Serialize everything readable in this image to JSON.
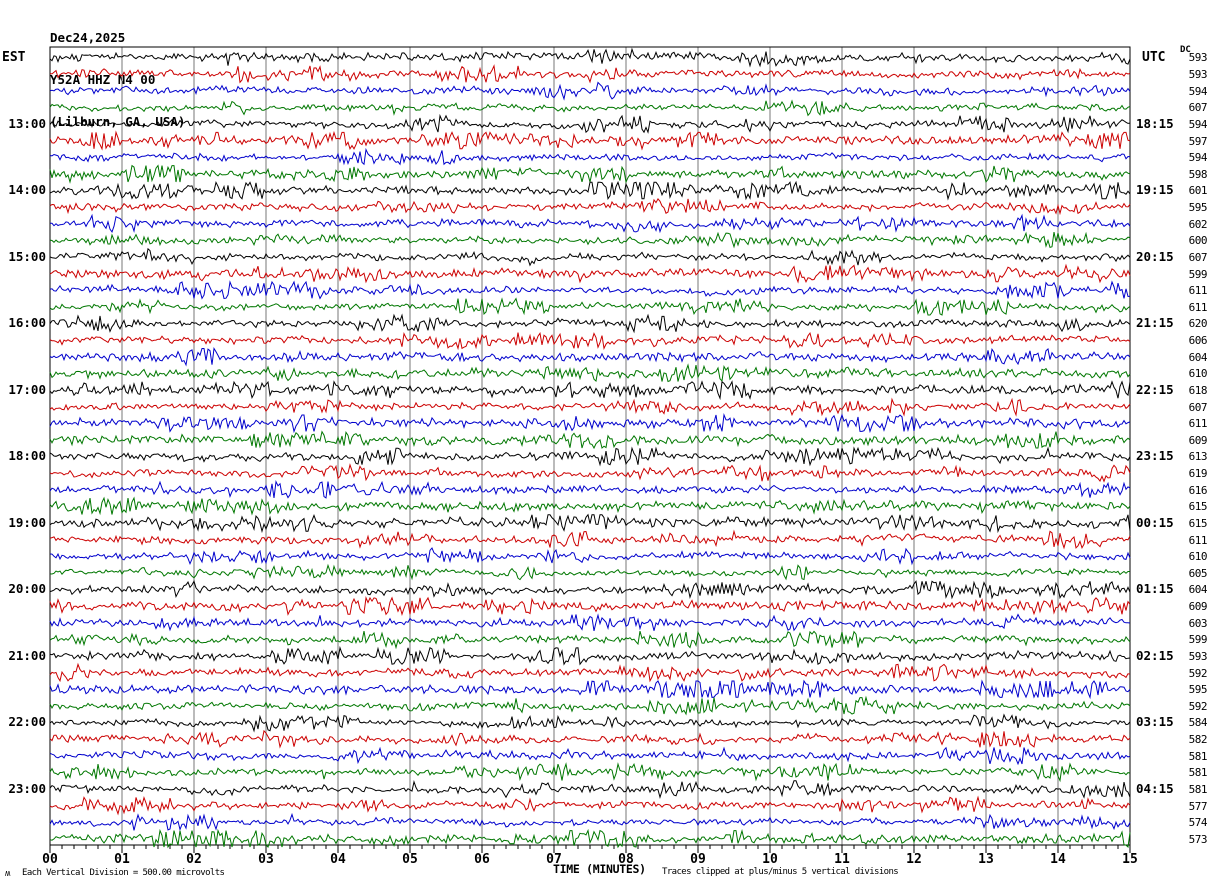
{
  "header": {
    "date": "Dec24,2025",
    "station": "Y52A HHZ N4 00",
    "location": "(Lilburn, GA, USA)"
  },
  "left_axis": {
    "timezone_label": "EST",
    "hour_labels": [
      "13:00",
      "14:00",
      "15:00",
      "16:00",
      "17:00",
      "18:00",
      "19:00",
      "20:00",
      "21:00",
      "22:00",
      "23:00"
    ]
  },
  "right_axis": {
    "timezone_label": "UTC",
    "dc_column_header": "DC",
    "hour_labels": [
      "18:15",
      "19:15",
      "20:15",
      "21:15",
      "22:15",
      "23:15",
      "00:15",
      "01:15",
      "02:15",
      "03:15",
      "04:15"
    ]
  },
  "x_axis": {
    "title": "TIME (MINUTES)",
    "minute_labels": [
      "00",
      "01",
      "02",
      "03",
      "04",
      "05",
      "06",
      "07",
      "08",
      "09",
      "10",
      "11",
      "12",
      "13",
      "14",
      "15"
    ]
  },
  "footer": {
    "scale_note": "Each Vertical Division =  500.00 microvolts",
    "clip_note": "Traces clipped at plus/minus 5 vertical divisions",
    "corner_glyph": "ʍ"
  },
  "chart_data": {
    "type": "line",
    "subtype": "helicorder_seismogram",
    "title": "Y52A HHZ N4 00 (Lilburn, GA, USA) Dec24,2025",
    "xlabel": "TIME (MINUTES)",
    "x_range_minutes": [
      0,
      15
    ],
    "major_tick_minutes": 1,
    "minor_tick_seconds": 10,
    "rows_total": 48,
    "row_duration_minutes": 15,
    "traces_per_hour": 4,
    "first_hour_label_row_index": 4,
    "hour_label_row_step": 4,
    "row_color_cycle": [
      "black",
      "red",
      "blue",
      "green"
    ],
    "trace_color_hex": {
      "black": "#000000",
      "red": "#cc0000",
      "blue": "#0000cc",
      "green": "#007700"
    },
    "grid_color": "#777777",
    "border_color": "#000000",
    "dc_values": [
      593,
      593,
      594,
      607,
      594,
      597,
      594,
      598,
      601,
      595,
      602,
      600,
      607,
      599,
      611,
      611,
      620,
      606,
      604,
      610,
      618,
      607,
      611,
      609,
      613,
      619,
      616,
      615,
      615,
      611,
      610,
      605,
      604,
      609,
      603,
      599,
      593,
      592,
      595,
      592,
      584,
      582,
      581,
      581,
      581,
      577,
      574,
      573
    ],
    "amplitude_scale_note": "Each Vertical Division =  500.00 microvolts",
    "clipping_note": "Traces clipped at plus/minus 5 vertical divisions",
    "waveform_note": "continuous ambient seismic background noise; individual sample values are not labeled in the image"
  }
}
